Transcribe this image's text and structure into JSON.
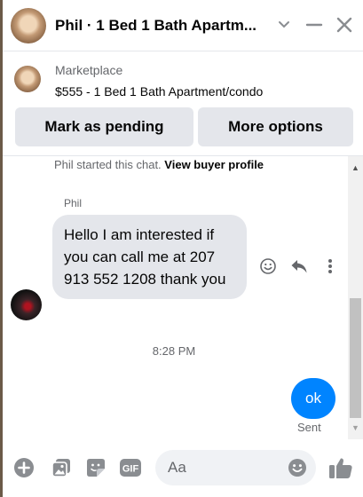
{
  "header": {
    "title": "Phil · 1 Bed 1 Bath Apartm..."
  },
  "marketplace": {
    "label": "Marketplace",
    "listing": "$555 - 1 Bed 1 Bath Apartment/condo",
    "buttons": {
      "mark_pending": "Mark as pending",
      "more_options": "More options"
    }
  },
  "chat": {
    "started_text": "Phil started this chat.",
    "view_profile": "View buyer profile",
    "sender_name": "Phil",
    "incoming_message": "Hello I am interested if you can call me at 207 913 552 1208 thank you",
    "timestamp": "8:28 PM",
    "outgoing_message": "ok",
    "status": "Sent"
  },
  "composer": {
    "placeholder": "Aa"
  },
  "colors": {
    "accent": "#0084ff",
    "bubble_incoming": "#e4e6eb",
    "secondary_text": "#65676b"
  },
  "icons": [
    "chevron-down-icon",
    "minimize-icon",
    "close-icon",
    "emoji-icon",
    "reply-icon",
    "more-icon",
    "plus-icon",
    "image-icon",
    "sticker-icon",
    "gif-icon",
    "like-icon"
  ]
}
